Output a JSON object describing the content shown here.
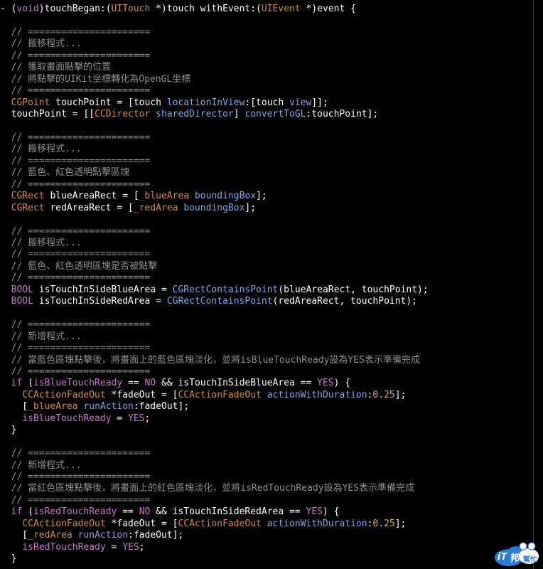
{
  "editor": {
    "colors": {
      "background": "#000000",
      "plain": "#ffffff",
      "comment": "#8e8e8e",
      "type": "#d98a2b",
      "keyword": "#c874c8",
      "method": "#7aa7e8",
      "number": "#d8b040"
    },
    "lines": [
      [
        [
          "plain",
          "- ("
        ],
        [
          "keyword",
          "void"
        ],
        [
          "plain",
          ")touchBegan:("
        ],
        [
          "type",
          "UITouch"
        ],
        [
          "plain",
          " *)touch withEvent:("
        ],
        [
          "type",
          "UIEvent"
        ],
        [
          "plain",
          " *)event {"
        ]
      ],
      [],
      [
        [
          "comment",
          "  // ======================"
        ]
      ],
      [
        [
          "comment",
          "  // 搬移程式..."
        ]
      ],
      [
        [
          "comment",
          "  // ======================"
        ]
      ],
      [
        [
          "comment",
          "  // 獲取畫面點擊的位置"
        ]
      ],
      [
        [
          "comment",
          "  // 將點擊的UIKit坐標轉化為OpenGL坐標"
        ]
      ],
      [
        [
          "comment",
          "  // ======================"
        ]
      ],
      [
        [
          "type",
          "  CGPoint"
        ],
        [
          "plain",
          " touchPoint = [touch "
        ],
        [
          "method",
          "locationInView"
        ],
        [
          "plain",
          ":[touch "
        ],
        [
          "method",
          "view"
        ],
        [
          "plain",
          "]];"
        ]
      ],
      [
        [
          "plain",
          "  touchPoint = [["
        ],
        [
          "type",
          "CCDirector"
        ],
        [
          "plain",
          " "
        ],
        [
          "method",
          "sharedDirector"
        ],
        [
          "plain",
          "] "
        ],
        [
          "method",
          "convertToGL"
        ],
        [
          "plain",
          ":touchPoint];"
        ]
      ],
      [],
      [
        [
          "comment",
          "  // ======================"
        ]
      ],
      [
        [
          "comment",
          "  // 搬移程式..."
        ]
      ],
      [
        [
          "comment",
          "  // ======================"
        ]
      ],
      [
        [
          "comment",
          "  // 藍色、紅色透明點擊區塊"
        ]
      ],
      [
        [
          "comment",
          "  // ======================"
        ]
      ],
      [
        [
          "type",
          "  CGRect"
        ],
        [
          "plain",
          " blueAreaRect = ["
        ],
        [
          "ivar",
          "_blueArea"
        ],
        [
          "plain",
          " "
        ],
        [
          "method",
          "boundingBox"
        ],
        [
          "plain",
          "];"
        ]
      ],
      [
        [
          "type",
          "  CGRect"
        ],
        [
          "plain",
          " redAreaRect = ["
        ],
        [
          "ivar",
          "_redArea"
        ],
        [
          "plain",
          " "
        ],
        [
          "method",
          "boundingBox"
        ],
        [
          "plain",
          "];"
        ]
      ],
      [],
      [
        [
          "comment",
          "  // ======================"
        ]
      ],
      [
        [
          "comment",
          "  // 搬移程式..."
        ]
      ],
      [
        [
          "comment",
          "  // ======================"
        ]
      ],
      [
        [
          "comment",
          "  // 藍色、紅色透明區塊是否被點擊"
        ]
      ],
      [
        [
          "comment",
          "  // ======================"
        ]
      ],
      [
        [
          "keyword",
          "  BOOL"
        ],
        [
          "plain",
          " isTouchInSideBlueArea = "
        ],
        [
          "method",
          "CGRectContainsPoint"
        ],
        [
          "plain",
          "(blueAreaRect, touchPoint);"
        ]
      ],
      [
        [
          "keyword",
          "  BOOL"
        ],
        [
          "plain",
          " isTouchInSideRedArea = "
        ],
        [
          "method",
          "CGRectContainsPoint"
        ],
        [
          "plain",
          "(redAreaRect, touchPoint);"
        ]
      ],
      [],
      [
        [
          "comment",
          "  // ======================"
        ]
      ],
      [
        [
          "comment",
          "  // 新增程式..."
        ]
      ],
      [
        [
          "comment",
          "  // ======================"
        ]
      ],
      [
        [
          "comment",
          "  // 當藍色區塊點擊後，將畫面上的藍色區塊淡化，並將isBlueTouchReady設為YES表示準備完成"
        ]
      ],
      [
        [
          "comment",
          "  // ======================"
        ]
      ],
      [
        [
          "keyword",
          "  if"
        ],
        [
          "plain",
          " ("
        ],
        [
          "keyword",
          "isBlueTouchReady"
        ],
        [
          "plain",
          " == "
        ],
        [
          "keyword",
          "NO"
        ],
        [
          "plain",
          " && isTouchInSideBlueArea == "
        ],
        [
          "keyword",
          "YES"
        ],
        [
          "plain",
          ") {"
        ]
      ],
      [
        [
          "type",
          "    CCActionFadeOut"
        ],
        [
          "plain",
          " *fadeOut = ["
        ],
        [
          "type",
          "CCActionFadeOut"
        ],
        [
          "plain",
          " "
        ],
        [
          "method",
          "actionWithDuration"
        ],
        [
          "plain",
          ":"
        ],
        [
          "number",
          "0.25"
        ],
        [
          "plain",
          "];"
        ]
      ],
      [
        [
          "plain",
          "    ["
        ],
        [
          "ivar",
          "_blueArea"
        ],
        [
          "plain",
          " "
        ],
        [
          "method",
          "runAction"
        ],
        [
          "plain",
          ":fadeOut];"
        ]
      ],
      [
        [
          "keyword",
          "    isBlueTouchReady"
        ],
        [
          "plain",
          " = "
        ],
        [
          "keyword",
          "YES"
        ],
        [
          "plain",
          ";"
        ]
      ],
      [
        [
          "plain",
          "  }"
        ]
      ],
      [],
      [
        [
          "comment",
          "  // ======================"
        ]
      ],
      [
        [
          "comment",
          "  // 新增程式..."
        ]
      ],
      [
        [
          "comment",
          "  // ======================"
        ]
      ],
      [
        [
          "comment",
          "  // 當紅色區塊點擊後，將畫面上的紅色區塊淡化，並將isRedTouchReady設為YES表示準備完成"
        ]
      ],
      [
        [
          "comment",
          "  // ======================"
        ]
      ],
      [
        [
          "keyword",
          "  if"
        ],
        [
          "plain",
          " ("
        ],
        [
          "keyword",
          "isRedTouchReady"
        ],
        [
          "plain",
          " == "
        ],
        [
          "keyword",
          "NO"
        ],
        [
          "plain",
          " && isTouchInSideRedArea == "
        ],
        [
          "keyword",
          "YES"
        ],
        [
          "plain",
          ") {"
        ]
      ],
      [
        [
          "type",
          "    CCActionFadeOut"
        ],
        [
          "plain",
          " *fadeOut = ["
        ],
        [
          "type",
          "CCActionFadeOut"
        ],
        [
          "plain",
          " "
        ],
        [
          "method",
          "actionWithDuration"
        ],
        [
          "plain",
          ":"
        ],
        [
          "number",
          "0.25"
        ],
        [
          "plain",
          "];"
        ]
      ],
      [
        [
          "plain",
          "    ["
        ],
        [
          "ivar",
          "_redArea"
        ],
        [
          "plain",
          " "
        ],
        [
          "method",
          "runAction"
        ],
        [
          "plain",
          ":fadeOut];"
        ]
      ],
      [
        [
          "keyword",
          "    isRedTouchReady"
        ],
        [
          "plain",
          " = "
        ],
        [
          "keyword",
          "YES"
        ],
        [
          "plain",
          ";"
        ]
      ],
      [
        [
          "plain",
          "  }"
        ]
      ]
    ]
  },
  "watermark": {
    "brand": "iT",
    "brand_cn": "邦",
    "sub": "幫忙"
  }
}
